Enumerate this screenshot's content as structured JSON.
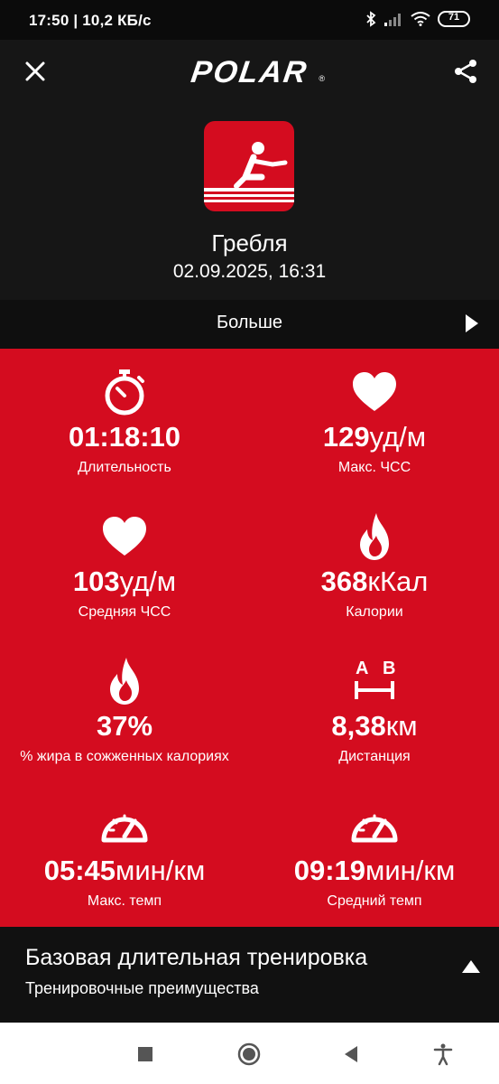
{
  "status_bar": {
    "time_speed": "17:50 | 10,2 КБ/с",
    "battery": "71",
    "icons": [
      "bluetooth-icon",
      "signal-icon",
      "wifi-icon",
      "battery-icon"
    ]
  },
  "app_bar": {
    "close_icon": "close-icon",
    "logo_text": "POLAR",
    "share_icon": "share-icon"
  },
  "session": {
    "sport_icon": "rowing-icon",
    "sport_name": "Гребля",
    "datetime": "02.09.2025, 16:31",
    "more_label": "Больше"
  },
  "stats": [
    {
      "icon": "stopwatch-icon",
      "value": "01:18:10",
      "unit": "",
      "label": "Длительность"
    },
    {
      "icon": "heart-icon",
      "value": "129",
      "unit": "уд/м",
      "label": "Макс. ЧСС"
    },
    {
      "icon": "heart-icon",
      "value": "103",
      "unit": "уд/м",
      "label": "Средняя ЧСС"
    },
    {
      "icon": "flame-icon",
      "value": "368",
      "unit": "кКал",
      "label": "Калории"
    },
    {
      "icon": "flame-icon",
      "value": "37%",
      "unit": "",
      "label": "% жира в сожженных калориях"
    },
    {
      "icon": "distance-ab-icon",
      "value": "8,38",
      "unit": "км",
      "label": "Дистанция"
    },
    {
      "icon": "speedometer-icon",
      "value": "05:45",
      "unit": "мин/км",
      "label": "Макс. темп"
    },
    {
      "icon": "speedometer-icon",
      "value": "09:19",
      "unit": "мин/км",
      "label": "Средний темп"
    }
  ],
  "distance_icon_letters": {
    "a": "A",
    "b": "B"
  },
  "training": {
    "title": "Базовая длительная тренировка",
    "subtitle": "Тренировочные преимущества"
  },
  "nav_bar": {
    "icons": [
      "recents-icon",
      "home-icon",
      "back-icon",
      "accessibility-icon"
    ]
  },
  "colors": {
    "accent_red": "#d40c1f",
    "header_bg": "#161616",
    "background": "#000000"
  }
}
